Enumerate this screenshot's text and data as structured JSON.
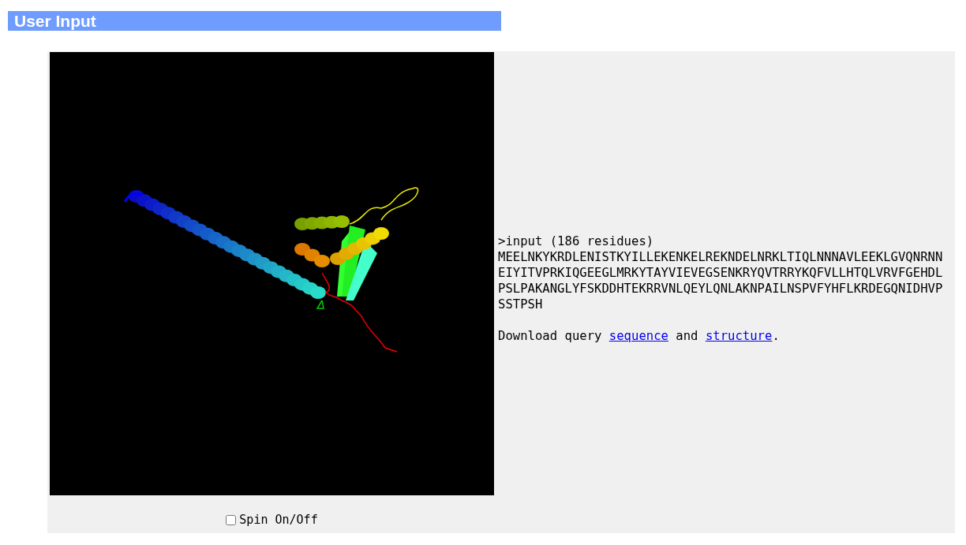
{
  "header": {
    "title": "User Input"
  },
  "query": {
    "heading": ">input (186 residues)",
    "sequence_lines": [
      "MEELNKYKRDLENISTKYILLEKENKELREKNDELNRKLTIQLNNNAVLEEKLGVQNRNN",
      "EIYITVPRKIQGEEGLMRKYTAYVIEVEGSENKRYQVTRRYKQFVLLHTQLVRVFGEHDL",
      "PSLPAKANGLYFSKDDHTEKRRVNLQEYLQNLAKNPAILNSPVFYHFLKRDEGQNIDHVP",
      "SSTPSH"
    ],
    "download": {
      "prefix": "Download query",
      "link_1": "sequence",
      "middle": "and",
      "link_2": "structure",
      "suffix": "."
    }
  },
  "viewer": {
    "spin": {
      "label": "Spin On/Off",
      "checked": false
    }
  }
}
